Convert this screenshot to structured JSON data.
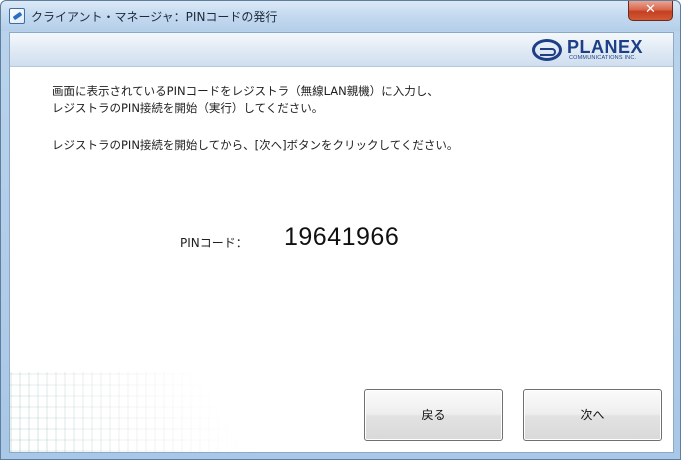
{
  "window": {
    "title": "クライアント・マネージャ：PINコードの発行",
    "close_label": "✕"
  },
  "banner": {
    "logo_word": "PLANEX",
    "logo_sub": "COMMUNICATIONS INC."
  },
  "instructions": {
    "line1": "画面に表示されているPINコードをレジストラ（無線LAN親機）に入力し、",
    "line2": "レジストラのPIN接続を開始（実行）してください。",
    "line3": "レジストラのPIN接続を開始してから、[次へ]ボタンをクリックしてください。"
  },
  "pin": {
    "label": "PINコード：",
    "value": "19641966"
  },
  "buttons": {
    "back": "戻る",
    "next": "次へ"
  }
}
